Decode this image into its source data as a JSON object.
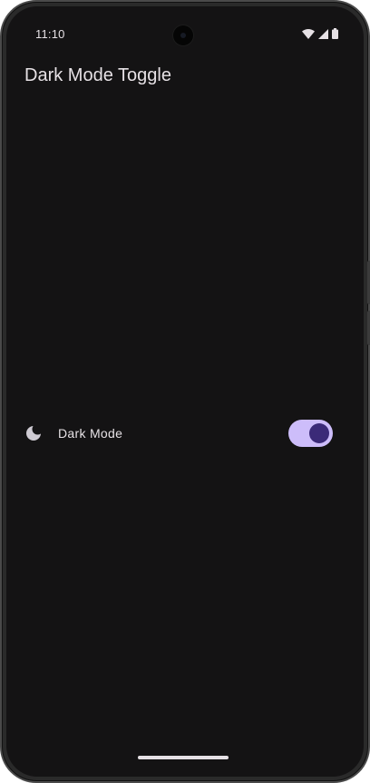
{
  "status_bar": {
    "time": "11:10",
    "icons": [
      "wifi-icon",
      "cellular-signal-icon",
      "battery-icon"
    ]
  },
  "app": {
    "title": "Dark Mode Toggle"
  },
  "settings": {
    "dark_mode": {
      "icon": "moon-icon",
      "label": "Dark Mode",
      "enabled": true
    }
  },
  "colors": {
    "background": "#141314",
    "text": "#e6e1e5",
    "switch_track_on": "#cdbdfa",
    "switch_thumb_on": "#3b2a78"
  }
}
